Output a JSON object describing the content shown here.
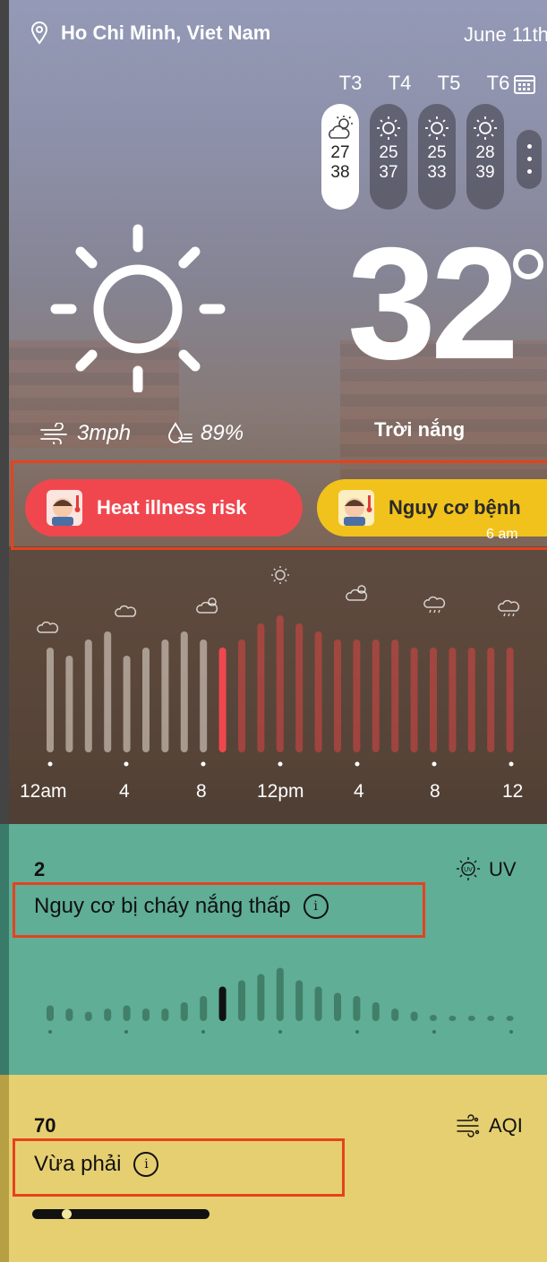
{
  "header": {
    "location": "Ho Chi Minh, Viet Nam",
    "date": "June 11th",
    "icons": {
      "location": "map-pin-icon",
      "calendar": "calendar-icon"
    }
  },
  "forecast": [
    {
      "day": "T3",
      "low": "27",
      "high": "38",
      "icon": "partly-cloudy-icon",
      "selected": true
    },
    {
      "day": "T4",
      "low": "25",
      "high": "37",
      "icon": "sun-icon",
      "selected": false
    },
    {
      "day": "T5",
      "low": "25",
      "high": "33",
      "icon": "sun-icon",
      "selected": false
    },
    {
      "day": "T6",
      "low": "28",
      "high": "39",
      "icon": "sun-icon",
      "selected": false
    }
  ],
  "current": {
    "temperature": "32",
    "condition": "Trời nắng",
    "wind": "3mph",
    "humidity": "89%"
  },
  "alerts": [
    {
      "label": "Heat illness risk",
      "color": "#f0474f"
    },
    {
      "label": "Nguy cơ bệnh",
      "color": "#f1c21b"
    }
  ],
  "alert_time_fragment": "6 am",
  "hourly": {
    "labels": [
      "12am",
      "4",
      "8",
      "12pm",
      "4",
      "8",
      "12"
    ],
    "current_index": 9,
    "levels": [
      0.65,
      0.6,
      0.7,
      0.75,
      0.6,
      0.65,
      0.7,
      0.75,
      0.7,
      0.65,
      0.7,
      0.8,
      0.85,
      0.8,
      0.75,
      0.7,
      0.7,
      0.7,
      0.7,
      0.65,
      0.65,
      0.65,
      0.65,
      0.65,
      0.65
    ]
  },
  "uv": {
    "value": "2",
    "label": "UV",
    "text": "Nguy cơ bị cháy nắng thấp",
    "levels": [
      0.25,
      0.2,
      0.15,
      0.2,
      0.25,
      0.2,
      0.2,
      0.3,
      0.4,
      0.55,
      0.65,
      0.75,
      0.85,
      0.65,
      0.55,
      0.45,
      0.4,
      0.3,
      0.2,
      0.15,
      0.1,
      0.08,
      0.08,
      0.08,
      0.08
    ],
    "current_index": 9
  },
  "aqi": {
    "value": "70",
    "label": "AQI",
    "text": "Vừa phải",
    "level": 0.19
  }
}
